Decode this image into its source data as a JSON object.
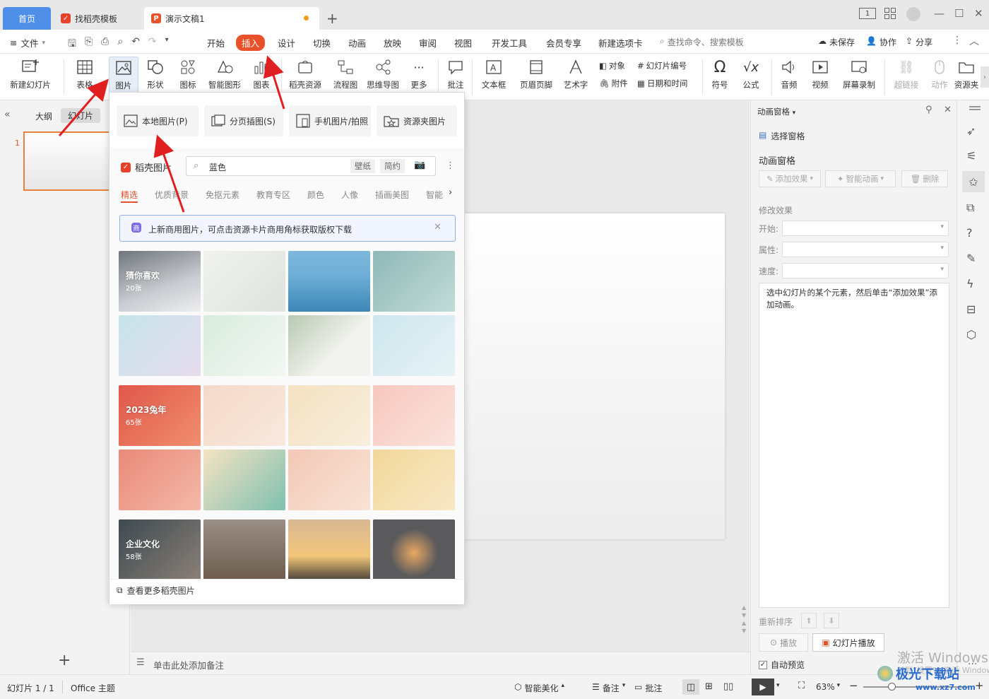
{
  "tabs": {
    "home": "首页",
    "template": "找稻壳模板",
    "document": "演示文稿1",
    "new_tab": "+"
  },
  "window": {
    "layout_badge": "1",
    "minimize": "—",
    "maximize": "☐",
    "close": "✕"
  },
  "menubar": {
    "file": "文件",
    "items": [
      "开始",
      "插入",
      "设计",
      "切换",
      "动画",
      "放映",
      "审阅",
      "视图",
      "开发工具",
      "会员专享",
      "新建选项卡"
    ],
    "search_placeholder": "查找命令、搜索模板",
    "unsaved": "未保存",
    "collaborate": "协作",
    "share": "分享"
  },
  "ribbon": {
    "new_slide": "新建幻灯片",
    "table": "表格",
    "picture": "图片",
    "shape": "形状",
    "icon": "图标",
    "smart_shape": "智能图形",
    "chart": "图表",
    "daoke_resource": "稻壳资源",
    "flowchart": "流程图",
    "mindmap": "思维导图",
    "more": "更多",
    "comment": "批注",
    "textbox": "文本框",
    "header_footer": "页眉页脚",
    "wordart": "艺术字",
    "object": "对象",
    "slide_number": "幻灯片编号",
    "attachment": "附件",
    "datetime": "日期和时间",
    "symbol": "符号",
    "formula": "公式",
    "audio": "音频",
    "video": "视频",
    "screen_record": "屏幕录制",
    "hyperlink": "超链接",
    "action": "动作",
    "resource_folder": "资源夹"
  },
  "left_panel": {
    "outline_tab": "大纲",
    "slides_tab": "幻灯片",
    "slide_index": "1",
    "add": "+"
  },
  "dropdown": {
    "local_picture": "本地图片(P)",
    "page_illustration": "分页插图(S)",
    "phone_picture": "手机图片/拍照",
    "resource_folder_picture": "资源夹图片",
    "brand": "稻壳图片",
    "search_value": "蓝色",
    "chip_wallpaper": "壁纸",
    "chip_simple": "简约",
    "categories": [
      "精选",
      "优质背景",
      "免抠元素",
      "教育专区",
      "颜色",
      "人像",
      "插画美图",
      "智能"
    ],
    "notice": "上新商用图片，可点击资源卡片商用角标获取版权下载",
    "groups": [
      {
        "title": "猜你喜欢",
        "count": "20张"
      },
      {
        "title": "2023兔年",
        "count": "65张"
      },
      {
        "title": "企业文化",
        "count": "58张"
      }
    ],
    "more_link": "查看更多稻壳图片"
  },
  "notes": {
    "placeholder": "单击此处添加备注"
  },
  "right_panel": {
    "header": "动画窗格",
    "select_pane": "选择窗格",
    "section_title": "动画窗格",
    "add_effect": "添加效果",
    "smart_animation": "智能动画",
    "delete": "删除",
    "modify_effect": "修改效果",
    "start_label": "开始:",
    "property_label": "属性:",
    "speed_label": "速度:",
    "hint": "选中幻灯片的某个元素，然后单击“添加效果”添加动画。",
    "reorder": "重新排序",
    "play": "播放",
    "slideshow_play": "幻灯片播放",
    "auto_preview": "自动预览"
  },
  "statusbar": {
    "slide_info": "幻灯片 1 / 1",
    "theme": "Office 主题",
    "smart_beautify": "智能美化",
    "notes": "备注",
    "comments": "批注",
    "zoom": "63%"
  },
  "watermark": {
    "line1": "激活 Windows",
    "line2": "转到“设置”以激活 Windows。",
    "site_name": "极光下载站",
    "site_url": "www.xz7.com"
  },
  "colors": {
    "accent": "#e8512a",
    "home_tab": "#4f8fe8",
    "arrow": "#e02020"
  }
}
